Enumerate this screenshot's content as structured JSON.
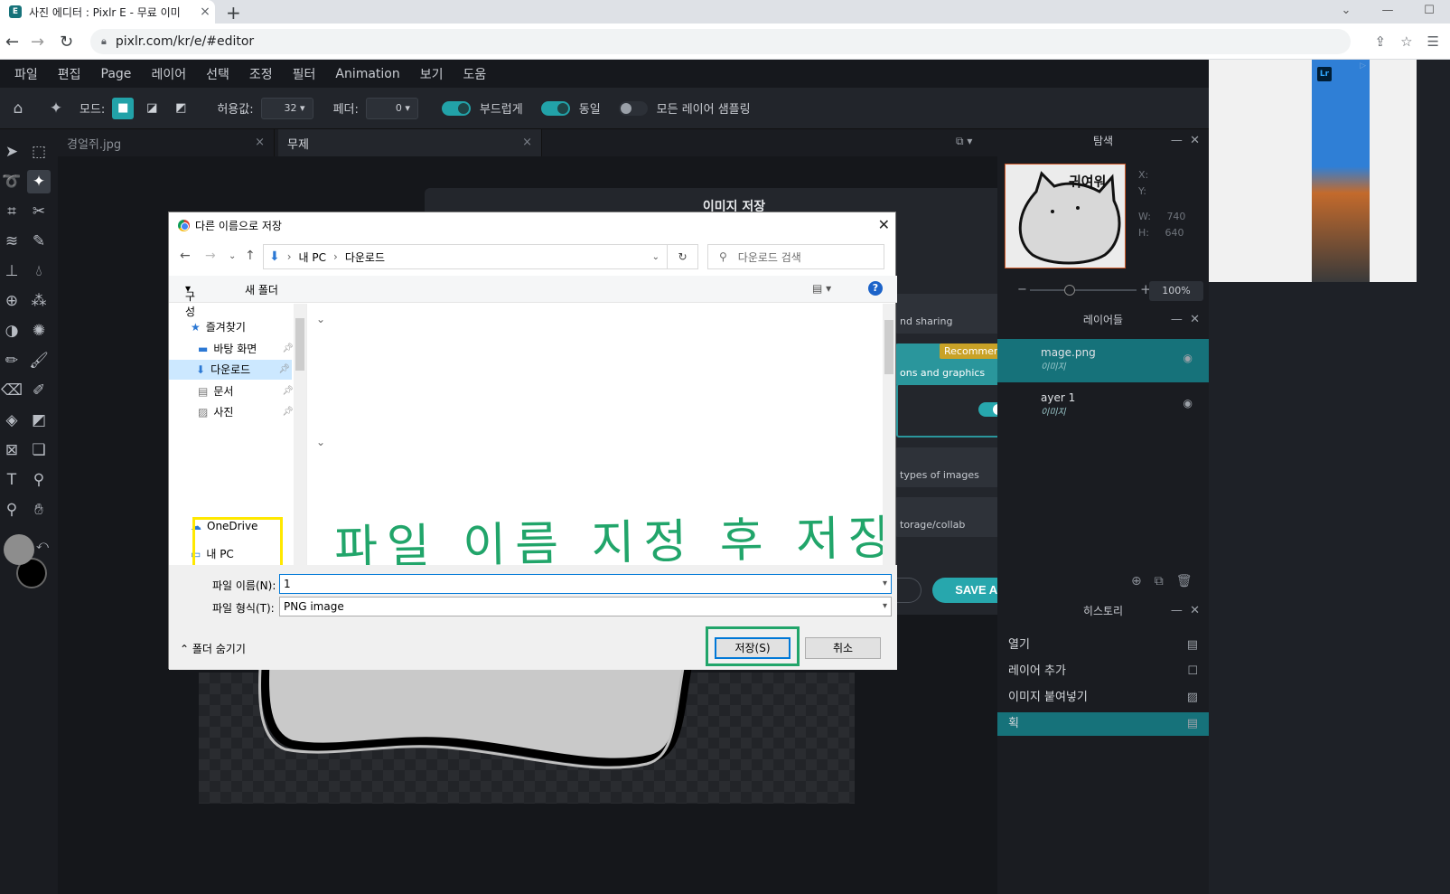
{
  "browser": {
    "tab_title": "사진 에디터 : Pixlr E - 무료 이미",
    "new_tab": "+",
    "url": "pixlr.com/kr/e/#editor"
  },
  "menu": [
    "파일",
    "편집",
    "Page",
    "레이어",
    "선택",
    "조정",
    "필터",
    "Animation",
    "보기",
    "도움"
  ],
  "options": {
    "mode_label": "모드:",
    "tolerance_label": "허용값:",
    "tolerance_value": "32",
    "feather_label": "페더:",
    "feather_value": "0",
    "smooth_label": "부드럽게",
    "contiguous_label": "동일",
    "sample_all_label": "모든 레이어 샘플링"
  },
  "doc_tabs": [
    "경얼쥐.jpg",
    "무제"
  ],
  "save_modal": {
    "title": "이미지 저장",
    "card1": "nd sharing",
    "card2": "ons and graphics",
    "recommend": "Recommend",
    "card3": "types of images",
    "card4": "torage/collab",
    "save_as": "SAVE AS"
  },
  "navigator": {
    "title": "탐색",
    "thumb_text": "귀여워",
    "x_label": "X:",
    "y_label": "Y:",
    "w_label": "W:",
    "w_value": "740",
    "h_label": "H:",
    "h_value": "640",
    "zoom": "100%"
  },
  "layers": {
    "title": "레이어들",
    "items": [
      {
        "name": "mage.png",
        "sub": "이미지"
      },
      {
        "name": "ayer 1",
        "sub": "이미지"
      }
    ]
  },
  "history": {
    "title": "히스토리",
    "items": [
      "열기",
      "레이어 추가",
      "이미지 붙여넣기",
      "획"
    ]
  },
  "dialog": {
    "title": "다른 이름으로 저장",
    "crumbs": [
      "내 PC",
      "다운로드"
    ],
    "search_placeholder": "다운로드 검색",
    "organize": "구성",
    "new_folder": "새 폴더",
    "tree": [
      "즐겨찾기",
      "바탕 화면",
      "다운로드",
      "문서",
      "사진",
      "OneDrive",
      "내 PC"
    ],
    "annotation": "파일 이름 지정 후 저장",
    "filename_label": "파일 이름(N):",
    "filename_value": "1",
    "filetype_label": "파일 형식(T):",
    "filetype_value": "PNG image",
    "hide_folders": "폴더 숨기기",
    "save": "저장(S)",
    "cancel": "취소"
  },
  "colors": {
    "accent": "#22a2a8",
    "selection_teal": "#16727a",
    "highlight_yellow": "#ffe800",
    "highlight_green": "#21a56a",
    "recommend_gold": "#c9a227"
  }
}
